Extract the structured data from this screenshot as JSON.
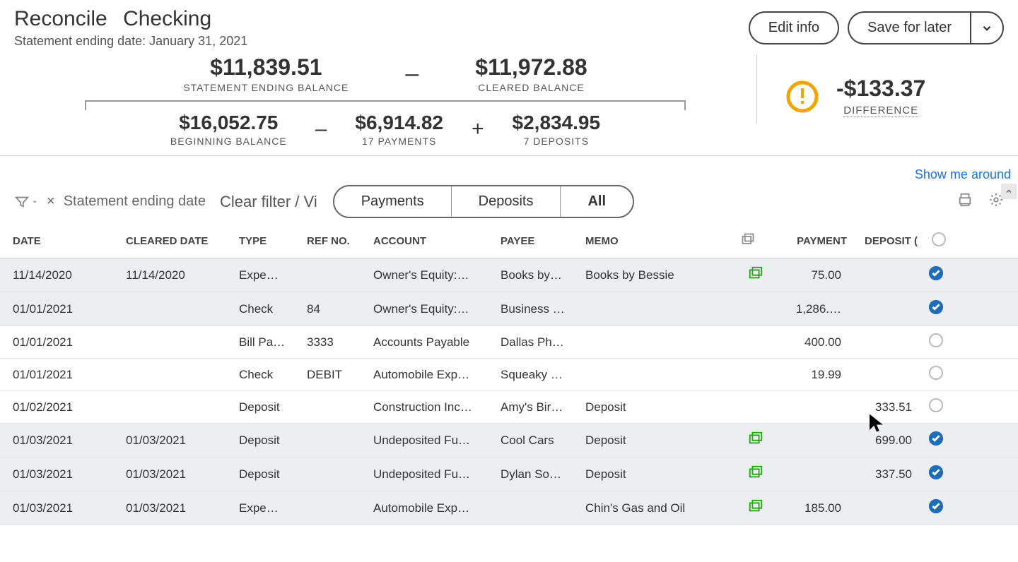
{
  "header": {
    "title_prefix": "Reconcile",
    "account": "Checking",
    "subtitle": "Statement ending date: January 31, 2021",
    "edit_btn": "Edit info",
    "save_btn": "Save for later"
  },
  "summary": {
    "stmt_end_val": "$11,839.51",
    "stmt_end_lbl": "STATEMENT ENDING BALANCE",
    "cleared_val": "$11,972.88",
    "cleared_lbl": "CLEARED BALANCE",
    "begin_val": "$16,052.75",
    "begin_lbl": "BEGINNING BALANCE",
    "payments_val": "$6,914.82",
    "payments_lbl": "17 PAYMENTS",
    "deposits_val": "$2,834.95",
    "deposits_lbl": "7 DEPOSITS",
    "diff_val": "-$133.37",
    "diff_lbl": "DIFFERENCE"
  },
  "showme": "Show me around",
  "toolbar": {
    "filter_text": "Statement ending date",
    "clear_link": "Clear filter / Vi",
    "seg_payments": "Payments",
    "seg_deposits": "Deposits",
    "seg_all": "All"
  },
  "columns": {
    "date": "DATE",
    "cleared": "CLEARED DATE",
    "type": "TYPE",
    "ref": "REF NO.",
    "account": "ACCOUNT",
    "payee": "PAYEE",
    "memo": "MEMO",
    "payment": "PAYMENT",
    "deposit": "DEPOSIT ("
  },
  "rows": [
    {
      "date": "11/14/2020",
      "cleared": "11/14/2020",
      "type": "Expe…",
      "ref": "",
      "account": "Owner's Equity:…",
      "payee": "Books by…",
      "memo": "Books by Bessie",
      "match": true,
      "payment": "75.00",
      "deposit": "",
      "checked": true,
      "sel": true
    },
    {
      "date": "01/01/2021",
      "cleared": "",
      "type": "Check",
      "ref": "84",
      "account": "Owner's Equity:…",
      "payee": "Business …",
      "memo": "",
      "match": false,
      "payment": "1,286.…",
      "deposit": "",
      "checked": true,
      "sel": true
    },
    {
      "date": "01/01/2021",
      "cleared": "",
      "type": "Bill Pa…",
      "ref": "3333",
      "account": "Accounts Payable",
      "payee": "Dallas Ph…",
      "memo": "",
      "match": false,
      "payment": "400.00",
      "deposit": "",
      "checked": false,
      "sel": false
    },
    {
      "date": "01/01/2021",
      "cleared": "",
      "type": "Check",
      "ref": "DEBIT",
      "account": "Automobile Exp…",
      "payee": "Squeaky …",
      "memo": "",
      "match": false,
      "payment": "19.99",
      "deposit": "",
      "checked": false,
      "sel": false
    },
    {
      "date": "01/02/2021",
      "cleared": "",
      "type": "Deposit",
      "ref": "",
      "account": "Construction Inc…",
      "payee": "Amy's Bir…",
      "memo": "Deposit",
      "match": false,
      "payment": "",
      "deposit": "333.51",
      "checked": false,
      "sel": false
    },
    {
      "date": "01/03/2021",
      "cleared": "01/03/2021",
      "type": "Deposit",
      "ref": "",
      "account": "Undeposited Fu…",
      "payee": "Cool Cars",
      "memo": "Deposit",
      "match": true,
      "payment": "",
      "deposit": "699.00",
      "checked": true,
      "sel": true
    },
    {
      "date": "01/03/2021",
      "cleared": "01/03/2021",
      "type": "Deposit",
      "ref": "",
      "account": "Undeposited Fu…",
      "payee": "Dylan So…",
      "memo": "Deposit",
      "match": true,
      "payment": "",
      "deposit": "337.50",
      "checked": true,
      "sel": true
    },
    {
      "date": "01/03/2021",
      "cleared": "01/03/2021",
      "type": "Expe…",
      "ref": "",
      "account": "Automobile Exp…",
      "payee": "",
      "memo": "Chin's Gas and Oil",
      "match": true,
      "payment": "185.00",
      "deposit": "",
      "checked": true,
      "sel": true
    }
  ]
}
